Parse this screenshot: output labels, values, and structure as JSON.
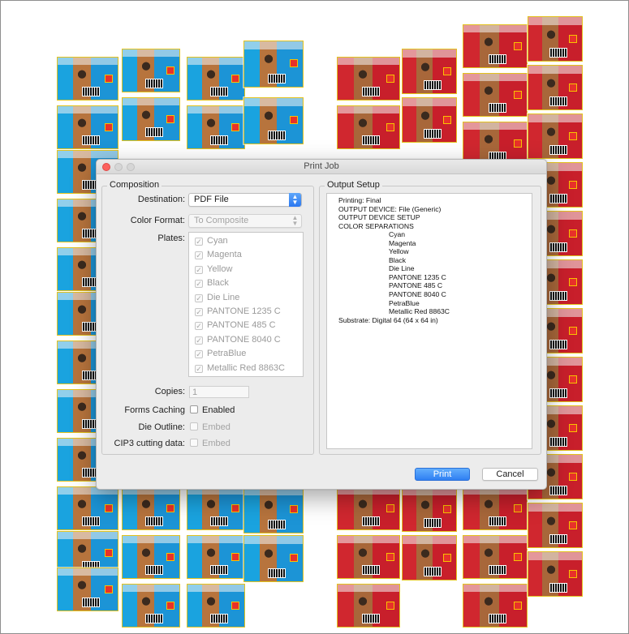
{
  "dialog": {
    "title": "Print Job",
    "buttons": {
      "print": "Print",
      "cancel": "Cancel"
    }
  },
  "composition": {
    "legend": "Composition",
    "destination": {
      "label": "Destination:",
      "value": "PDF File"
    },
    "color_format": {
      "label": "Color Format:",
      "value": "To Composite"
    },
    "plates": {
      "label": "Plates:",
      "items": [
        "Cyan",
        "Magenta",
        "Yellow",
        "Black",
        "Die Line",
        "PANTONE 1235 C",
        "PANTONE 485 C",
        "PANTONE 8040 C",
        "PetraBlue",
        "Metallic Red 8863C"
      ],
      "checked": true,
      "check_glyph": "✓"
    },
    "copies": {
      "label": "Copies:",
      "value": "1"
    },
    "forms_caching": {
      "label": "Forms Caching",
      "option": "Enabled",
      "checked": false
    },
    "die_outline": {
      "label": "Die Outline:",
      "option": "Embed",
      "checked": false
    },
    "cip3": {
      "label": "CIP3 cutting data:",
      "option": "Embed",
      "checked": false
    }
  },
  "output_setup": {
    "legend": "Output Setup",
    "lines": [
      {
        "text": "Printing: Final",
        "indent": 0
      },
      {
        "text": "OUTPUT DEVICE: File (Generic)",
        "indent": 0
      },
      {
        "text": "OUTPUT DEVICE SETUP",
        "indent": 0
      },
      {
        "text": "COLOR SEPARATIONS",
        "indent": 0
      },
      {
        "text": "Cyan",
        "indent": 1
      },
      {
        "text": "Magenta",
        "indent": 1
      },
      {
        "text": "Yellow",
        "indent": 1
      },
      {
        "text": "Black",
        "indent": 1
      },
      {
        "text": "Die Line",
        "indent": 1
      },
      {
        "text": "PANTONE 1235 C",
        "indent": 1
      },
      {
        "text": "PANTONE 485 C",
        "indent": 1
      },
      {
        "text": "PANTONE 8040 C",
        "indent": 1
      },
      {
        "text": "PetraBlue",
        "indent": 1
      },
      {
        "text": "Metallic Red 8863C",
        "indent": 1
      },
      {
        "text": "Substrate: Digital 64 (64 x 64 in)",
        "indent": 0
      }
    ]
  },
  "background": {
    "description_colors": {
      "blue_carton": "#1aa3df",
      "red_carton": "#d0272f",
      "die_line": "#e3c21d"
    }
  }
}
